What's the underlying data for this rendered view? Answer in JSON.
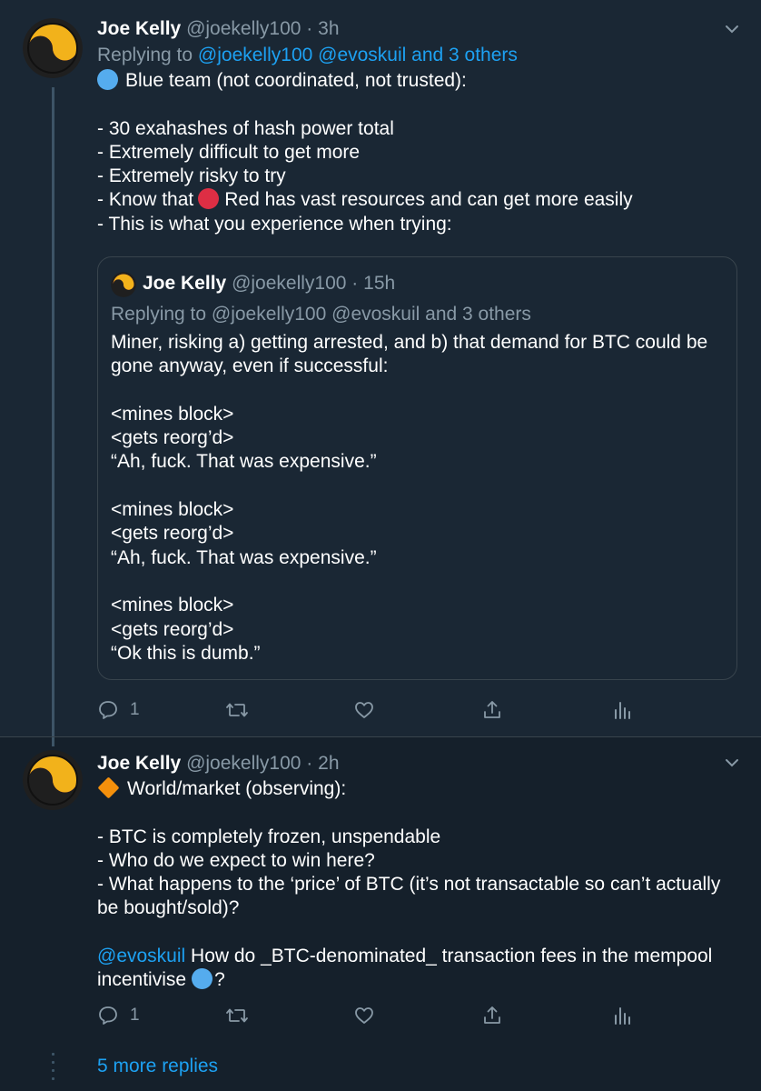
{
  "tweet1": {
    "name": "Joe Kelly",
    "handle": "@joekelly100",
    "dot": "·",
    "time": "3h",
    "replying_prefix": "Replying to",
    "replying_mentions": "@joekelly100 @evoskuil and 3 others",
    "lines": [
      "Blue team (not coordinated, not trusted):",
      "",
      "- 30 exahashes of hash power total",
      "- Extremely difficult to get more",
      "- Extremely risky to try",
      "- Know that",
      "Red has vast resources and can get more easily",
      "- This is what you experience when trying:"
    ],
    "quote": {
      "name": "Joe Kelly",
      "handle": "@joekelly100",
      "dot": "·",
      "time": "15h",
      "replying": "Replying to @joekelly100 @evoskuil and 3 others",
      "lines": [
        "Miner, risking a) getting arrested, and b) that demand for BTC could be gone anyway, even if successful:",
        "",
        "<mines block>",
        "<gets reorg’d>",
        "“Ah, fuck. That was expensive.”",
        "",
        "<mines block>",
        "<gets reorg’d>",
        "“Ah, fuck. That was expensive.”",
        "",
        "<mines block>",
        "<gets reorg’d>",
        "“Ok this is dumb.”"
      ]
    },
    "actions": {
      "reply_count": "1"
    }
  },
  "tweet2": {
    "name": "Joe Kelly",
    "handle": "@joekelly100",
    "dot": "·",
    "time": "2h",
    "lines": [
      "World/market (observing):",
      "",
      "- BTC is completely frozen, unspendable",
      "- Who do we expect to win here?",
      "- What happens to the ‘price’ of BTC (it’s not transactable so can’t actually be bought/sold)?",
      "",
      "@evoskuil",
      "How do _BTC-denominated_ transaction fees in the mempool incentivise",
      "?"
    ],
    "actions": {
      "reply_count": "1"
    }
  },
  "more_replies": "5 more replies",
  "icons": {
    "avatar": "yin-yang-logo-icon",
    "chevron": "chevron-down-icon",
    "reply": "reply-icon",
    "retweet": "retweet-icon",
    "like": "heart-icon",
    "share": "share-icon",
    "analytics": "analytics-icon"
  },
  "colors": {
    "background": "#15202b",
    "highlight": "#1a2734",
    "link": "#1da1f2",
    "muted": "#8899a6",
    "border": "#38444d",
    "emoji_blue": "#55acee",
    "emoji_red": "#dd2e44",
    "emoji_orange": "#f4900c"
  }
}
